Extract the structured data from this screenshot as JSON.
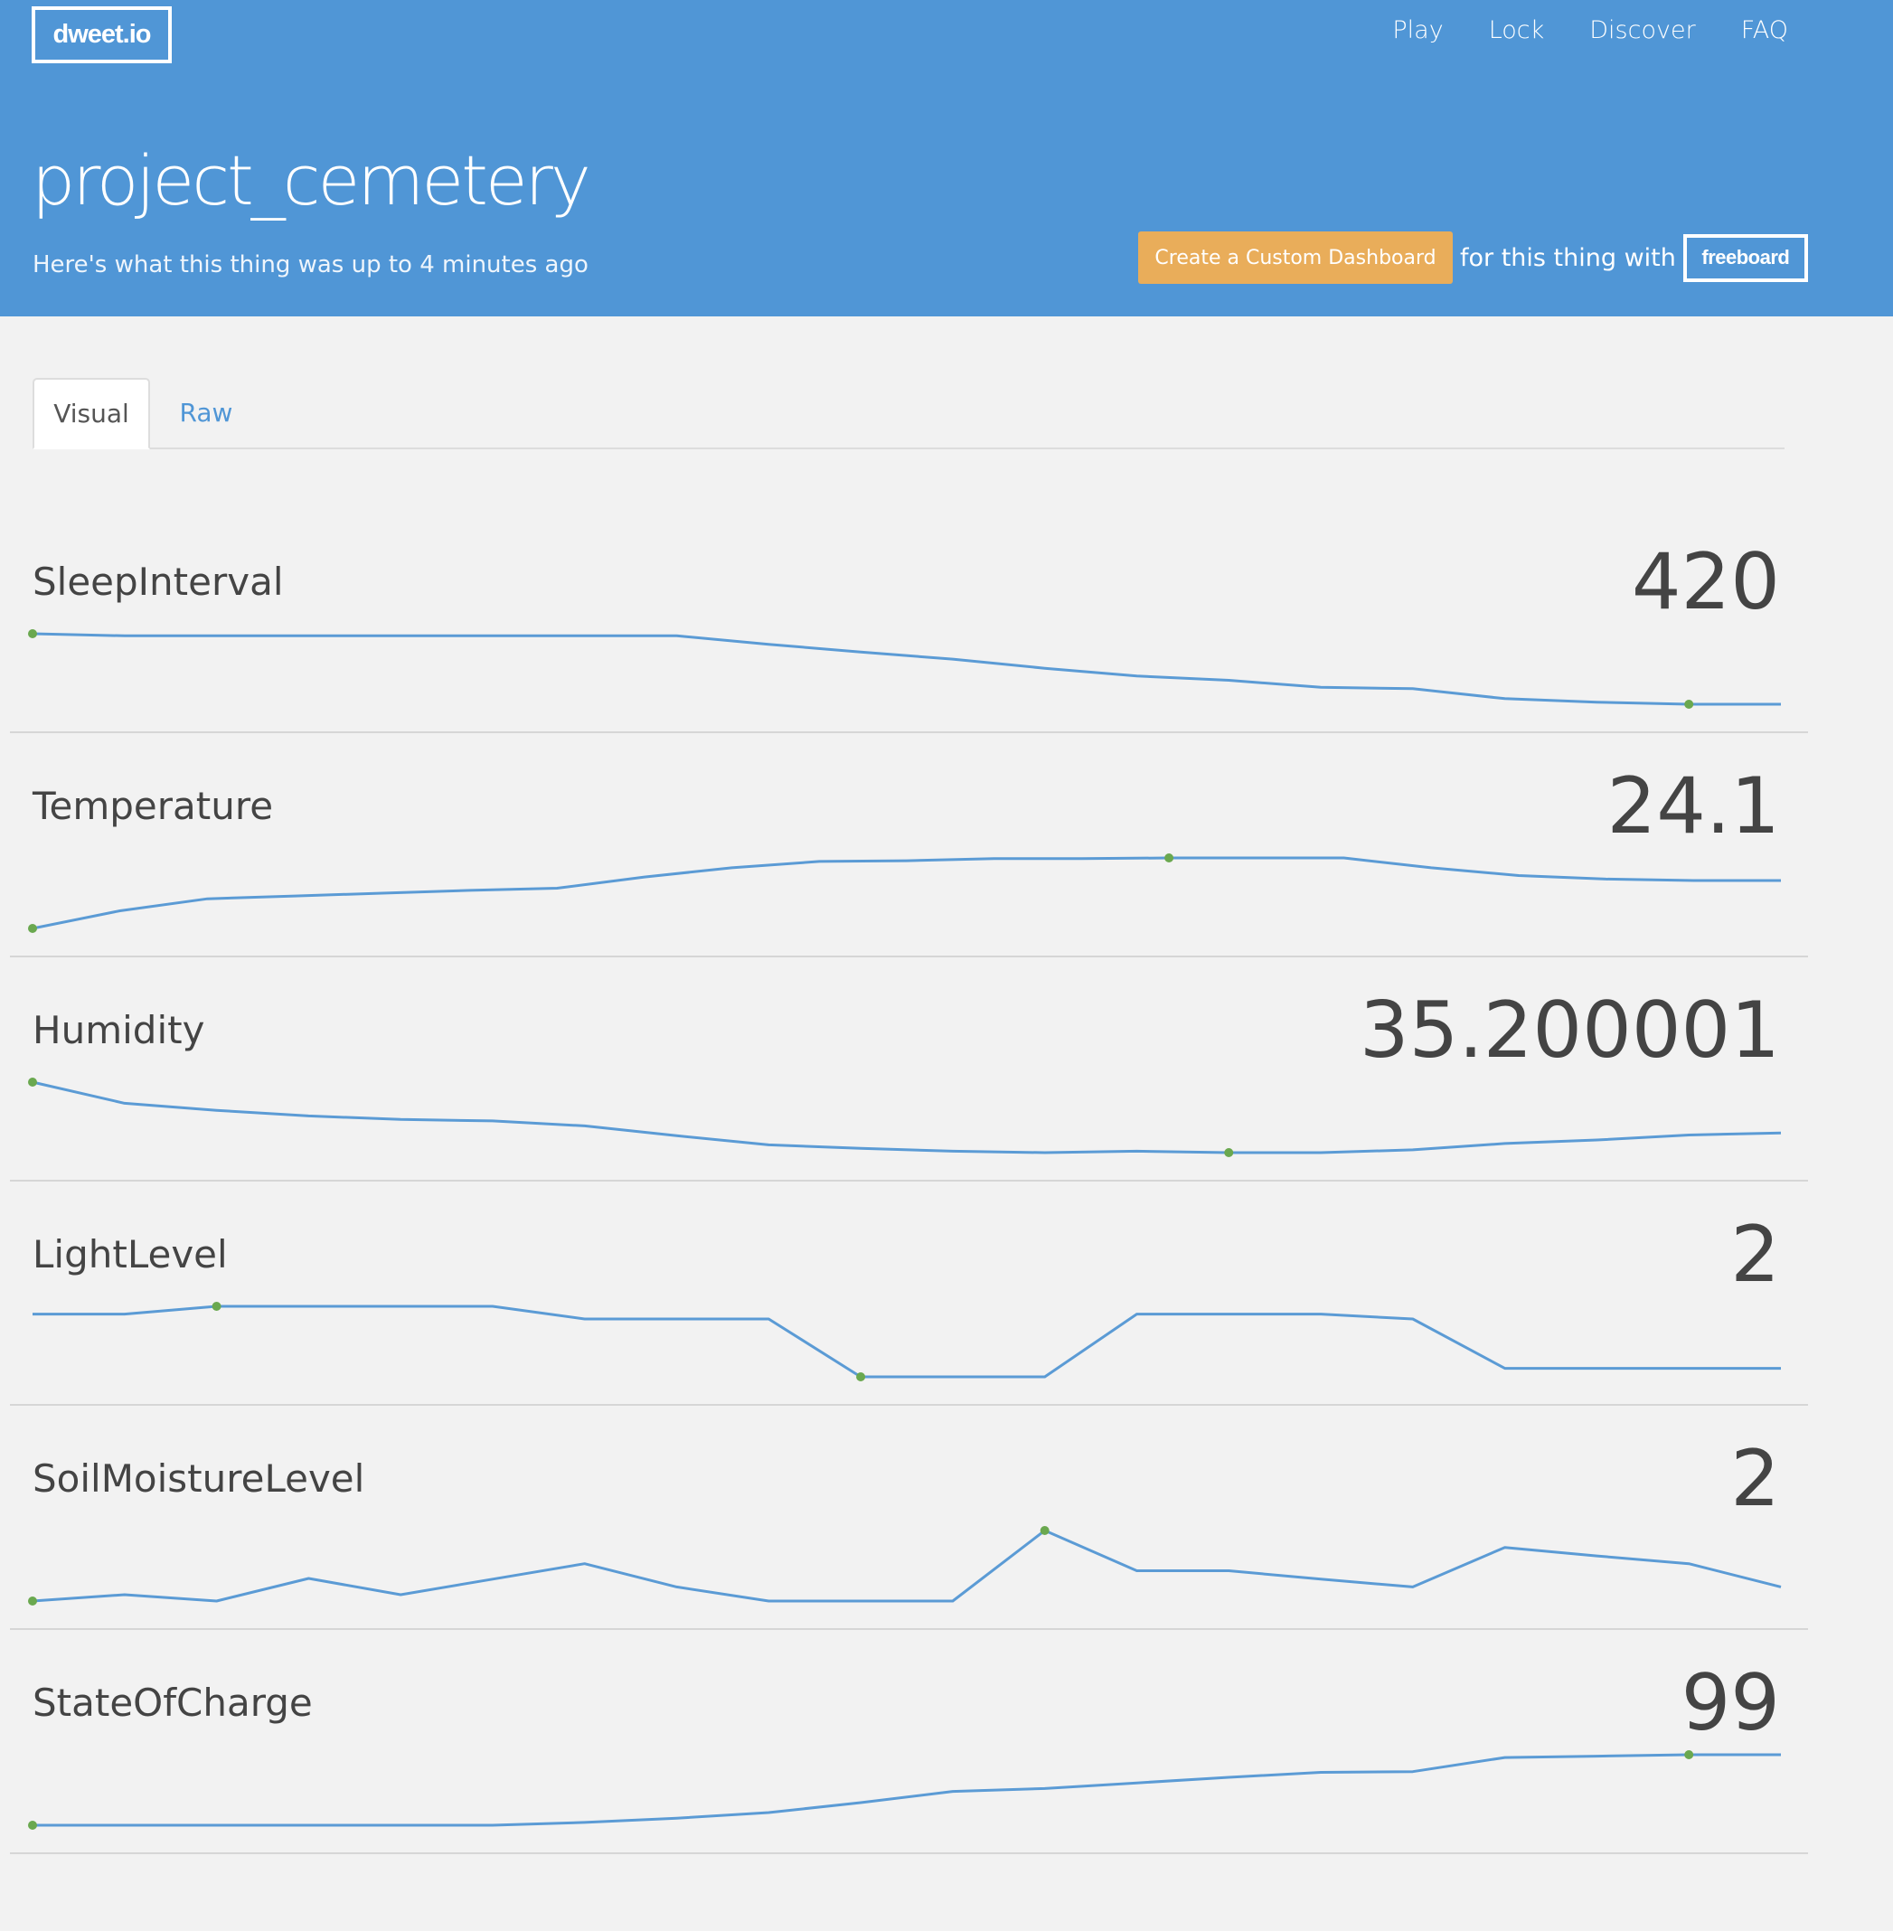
{
  "header": {
    "logo": "dweet.io",
    "nav": [
      "Play",
      "Lock",
      "Discover",
      "FAQ"
    ],
    "title": "project_cemetery",
    "subtitle": "Here's what this thing was up to 4 minutes ago",
    "dashboard_button": "Create a Custom Dashboard",
    "dashboard_text": "for this thing with",
    "freeboard_label": "freeboard"
  },
  "tabs": {
    "visual": "Visual",
    "raw": "Raw"
  },
  "colors": {
    "header_bg": "#5096d6",
    "accent_orange": "#e9ad5a",
    "line": "#5b9bd5",
    "marker": "#6aa84f"
  },
  "metrics": [
    {
      "name": "SleepInterval",
      "value": "420",
      "series": [
        1,
        0.97,
        0.97,
        0.97,
        0.97,
        0.97,
        0.97,
        0.97,
        0.85,
        0.74,
        0.64,
        0.51,
        0.4,
        0.34,
        0.24,
        0.22,
        0.08,
        0.03,
        0,
        0
      ],
      "markers": [
        0,
        18
      ]
    },
    {
      "name": "Temperature",
      "value": "24.1",
      "series": [
        0,
        0.25,
        0.42,
        0.46,
        0.5,
        0.54,
        0.57,
        0.73,
        0.86,
        0.95,
        0.96,
        0.99,
        0.99,
        1,
        1,
        1,
        0.86,
        0.75,
        0.7,
        0.68,
        0.68
      ],
      "markers": [
        0,
        13
      ]
    },
    {
      "name": "Humidity",
      "value": "35.200001",
      "series": [
        1,
        0.7,
        0.6,
        0.52,
        0.47,
        0.45,
        0.38,
        0.24,
        0.11,
        0.06,
        0.02,
        0,
        0.02,
        0,
        0,
        0.04,
        0.13,
        0.18,
        0.25,
        0.28
      ],
      "markers": [
        0,
        13
      ]
    },
    {
      "name": "LightLevel",
      "value": "2",
      "series": [
        0.89,
        0.89,
        1,
        1,
        1,
        1,
        0.82,
        0.82,
        0.82,
        0,
        0,
        0,
        0.89,
        0.89,
        0.89,
        0.82,
        0.12,
        0.12,
        0.12,
        0.12
      ],
      "markers": [
        2,
        9
      ]
    },
    {
      "name": "SoilMoistureLevel",
      "value": "2",
      "series": [
        0,
        0.09,
        0,
        0.32,
        0.09,
        0.31,
        0.53,
        0.2,
        0,
        0,
        0,
        1,
        0.43,
        0.43,
        0.31,
        0.2,
        0.76,
        0.64,
        0.53,
        0.2
      ],
      "markers": [
        0,
        11
      ]
    },
    {
      "name": "StateOfCharge",
      "value": "99",
      "series": [
        0,
        0,
        0,
        0,
        0,
        0,
        0.04,
        0.1,
        0.18,
        0.32,
        0.48,
        0.52,
        0.6,
        0.68,
        0.75,
        0.76,
        0.96,
        0.98,
        1,
        1
      ],
      "markers": [
        0,
        18
      ]
    }
  ]
}
